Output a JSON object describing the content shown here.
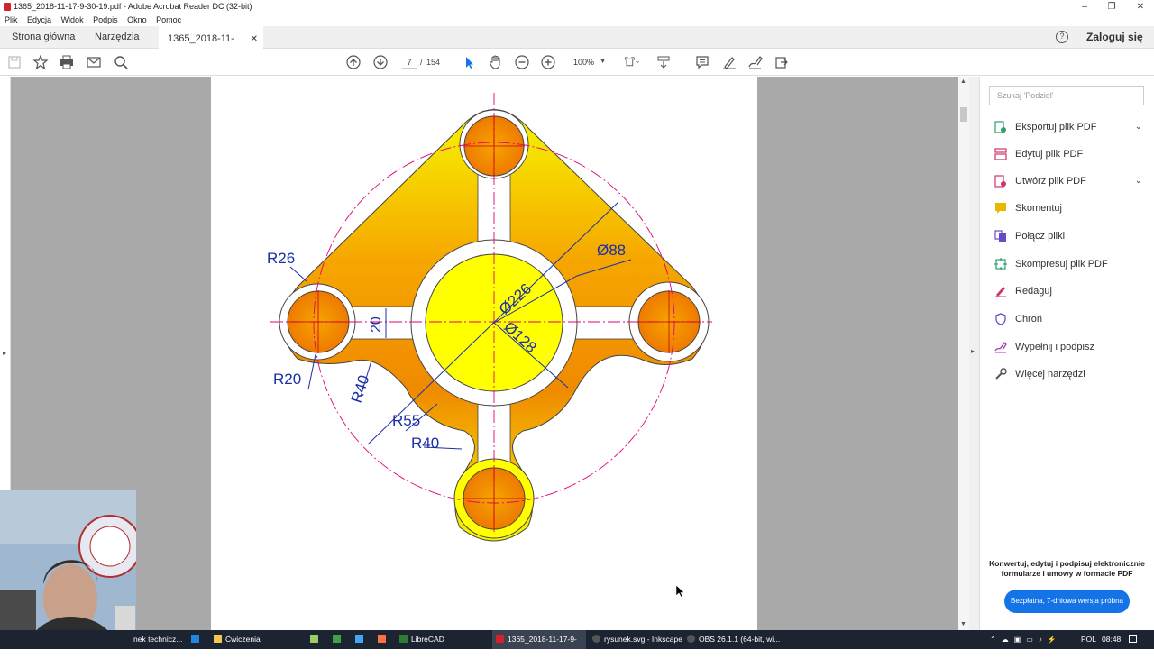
{
  "window": {
    "title": "1365_2018-11-17-9-30-19.pdf - Adobe Acrobat Reader DC (32-bit)"
  },
  "menu": [
    "Plik",
    "Edycja",
    "Widok",
    "Podpis",
    "Okno",
    "Pomoc"
  ],
  "tabs": {
    "home": "Strona główna",
    "tools": "Narzędzia",
    "doc": "1365_2018-11-17-...",
    "sign_in": "Zaloguj się"
  },
  "toolbar": {
    "page_current": "7",
    "page_sep": "/",
    "page_total": "154",
    "zoom": "100%"
  },
  "drawing": {
    "labels": {
      "r26": "R26",
      "r20": "R20",
      "r40a": "R40",
      "r55": "R55",
      "r40b": "R40",
      "d88": "Ø88",
      "d226": "Ø226",
      "d128": "Ø128",
      "w20": "20"
    },
    "colors": {
      "yellow": "#ffff00",
      "orange": "#f28c00",
      "dim": "#1b2fa8",
      "center": "#e0007a"
    }
  },
  "panel": {
    "search_placeholder": "Szukaj 'Podziel'",
    "tools": [
      {
        "label": "Eksportuj plik PDF",
        "icon": "export-pdf-icon",
        "color": "#2e9e6b",
        "expandable": true
      },
      {
        "label": "Edytuj plik PDF",
        "icon": "edit-pdf-icon",
        "color": "#d0336b",
        "expandable": false
      },
      {
        "label": "Utwórz plik PDF",
        "icon": "create-pdf-icon",
        "color": "#d0336b",
        "expandable": true
      },
      {
        "label": "Skomentuj",
        "icon": "comment-icon",
        "color": "#e6b800",
        "expandable": false
      },
      {
        "label": "Połącz pliki",
        "icon": "combine-files-icon",
        "color": "#6a4bc4",
        "expandable": false
      },
      {
        "label": "Skompresuj plik PDF",
        "icon": "compress-pdf-icon",
        "color": "#2e9e6b",
        "expandable": false
      },
      {
        "label": "Redaguj",
        "icon": "redact-icon",
        "color": "#d0336b",
        "expandable": false
      },
      {
        "label": "Chroń",
        "icon": "protect-icon",
        "color": "#6a4bc4",
        "expandable": false
      },
      {
        "label": "Wypełnij i podpisz",
        "icon": "fill-sign-icon",
        "color": "#9b3fb5",
        "expandable": false
      },
      {
        "label": "Więcej narzędzi",
        "icon": "more-tools-icon",
        "color": "#555555",
        "expandable": false
      }
    ],
    "promo_text": "Konwertuj, edytuj i podpisuj elektronicznie formularze i umowy w formacie PDF",
    "trial_button": "Bezpłatna, 7-dniowa wersja próbna"
  },
  "taskbar": {
    "items": [
      {
        "label": "nek technicz...",
        "color": "#1e88e5"
      },
      {
        "label": "Ćwiczenia",
        "color": "#f2c94c"
      },
      {
        "label": "LibreCAD",
        "color": "#2e7d32"
      },
      {
        "label": "1365_2018-11-17-9-30...",
        "color": "#d2232a"
      },
      {
        "label": "rysunek.svg - Inkscape",
        "color": "#333333"
      },
      {
        "label": "OBS 26.1.1 (64-bit, wi...",
        "color": "#333333"
      }
    ],
    "language": "POL",
    "clock": "08:48"
  }
}
